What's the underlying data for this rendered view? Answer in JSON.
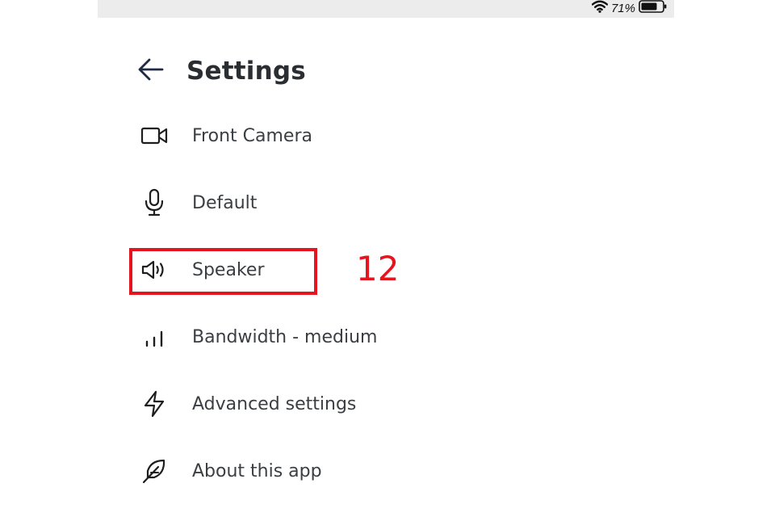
{
  "status_bar": {
    "battery_percent": "71%",
    "wifi_icon": "wifi-icon",
    "battery_icon": "battery-icon"
  },
  "header": {
    "back_icon": "arrow-left-icon",
    "title": "Settings"
  },
  "menu": {
    "items": [
      {
        "icon": "video-camera-icon",
        "label": "Front Camera"
      },
      {
        "icon": "microphone-icon",
        "label": "Default"
      },
      {
        "icon": "speaker-icon",
        "label": "Speaker"
      },
      {
        "icon": "signal-bars-icon",
        "label": "Bandwidth - medium"
      },
      {
        "icon": "lightning-icon",
        "label": "Advanced settings"
      },
      {
        "icon": "feather-icon",
        "label": "About this app"
      }
    ]
  },
  "annotation": {
    "label": "12",
    "color": "#e5141e"
  }
}
